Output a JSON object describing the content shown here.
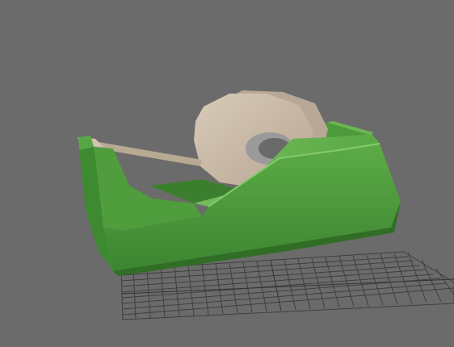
{
  "scene": {
    "subject": "tape-dispenser",
    "colors": {
      "background": "#6b6b6b",
      "grid_line": "#3e3e3e",
      "body_front": "#4e9a3c",
      "body_side": "#3f8a30",
      "body_top": "#6fba55",
      "body_dark": "#2f6e24",
      "tape_outer": "#c9b9a6",
      "tape_side": "#b8a794",
      "tape_core": "#8f8f8f",
      "tape_strip": "#b9aa95"
    }
  }
}
